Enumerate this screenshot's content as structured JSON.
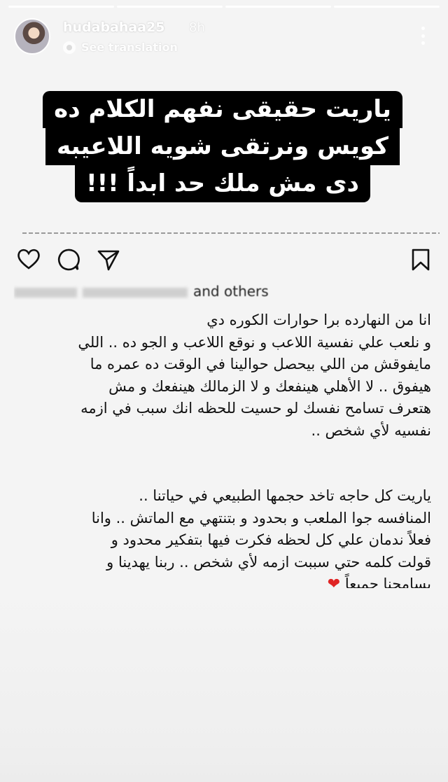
{
  "story": {
    "progress_segments": 4,
    "username": "hudabahaa25",
    "time": "8h",
    "see_translation": "See translation",
    "caption_lines": [
      "ياريت حقيقى نفهم الكلام ده",
      "كويس ونرتقى شويه اللاعيبه",
      "دى مش ملك حد ابداً !!!"
    ]
  },
  "post": {
    "likes_text": "and others",
    "paragraph1": [
      "انا من النهارده برا حوارات الكوره دي",
      "و نلعب علي نفسية اللاعب و نوقع اللاعب و الجو ده .. اللي",
      "مايفوقش من اللي بيحصل حوالينا في الوقت ده عمره ما",
      "هيفوق .. لا الأهلي هينفعك و لا الزمالك هينفعك و مش",
      "هتعرف تسامح نفسك لو حسيت للحظه انك سبب في ازمه",
      "نفسيه لأي شخص .."
    ],
    "paragraph2": [
      "ياريت كل حاجه تاخد حجمها الطبيعي في حياتنا ..",
      "المنافسه جوا الملعب و بحدود و بتنتهي مع الماتش .. وانا",
      "فعلاً ندمان علي كل لحظه فكرت فيها بتفكير محدود و",
      "قولت كلمه حتي سببت ازمه لأي شخص .. ربنا يهدينا و",
      "يسامحنا جميعاً",
      ".."
    ],
    "heart_glyph": "❤"
  }
}
